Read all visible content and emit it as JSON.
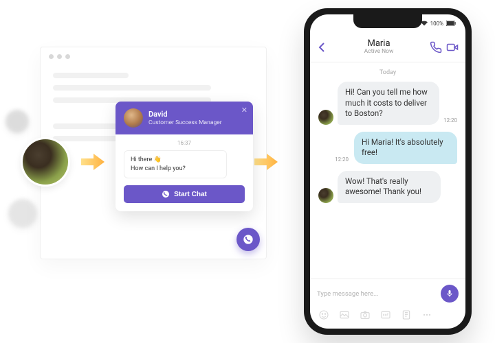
{
  "widget": {
    "agent_name": "David",
    "agent_role": "Customer Success Manager",
    "timestamp": "16:37",
    "greeting_line1": "Hi there 👋",
    "greeting_line2": "How can I help you?",
    "start_label": "Start Chat"
  },
  "phone": {
    "battery_pct": "100%",
    "contact_name": "Maria",
    "contact_status": "Active Now",
    "day_label": "Today",
    "msg1": "Hi! Can you tell me how much it costs to deliver to Boston?",
    "msg1_time": "12:20",
    "msg2": "Hi Maria! It's absolutely free!",
    "msg2_time": "12:20",
    "msg3": "Wow! That's really awesome! Thank you!",
    "msg3_time": "",
    "input_placeholder": "Type message here..."
  }
}
